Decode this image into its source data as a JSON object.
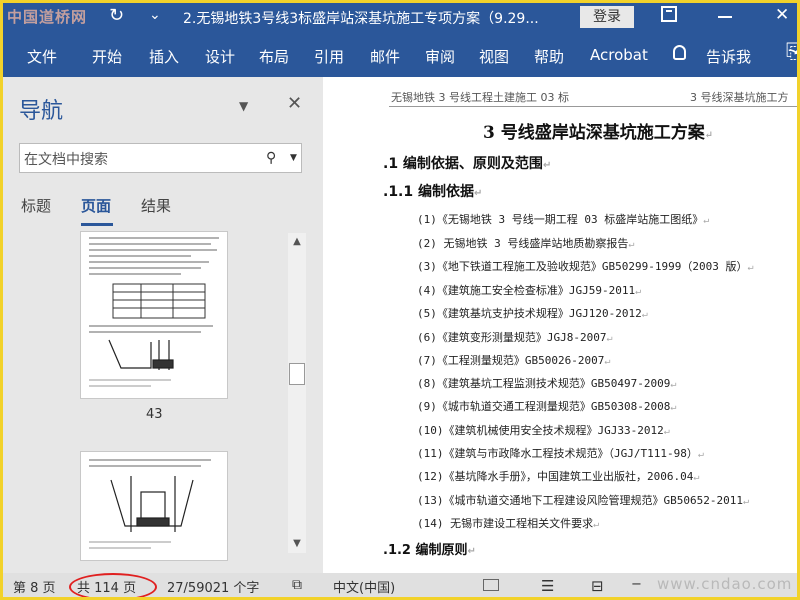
{
  "titlebar": {
    "watermark": "中国道桥网",
    "doc_title": "2.无锡地铁3号线3标盛岸站深基坑施工专项方案（9.29...",
    "login": "登录"
  },
  "ribbon": {
    "tabs": [
      "文件",
      "开始",
      "插入",
      "设计",
      "布局",
      "引用",
      "邮件",
      "审阅",
      "视图",
      "帮助",
      "Acrobat"
    ],
    "tell_me": "告诉我"
  },
  "nav": {
    "title": "导航",
    "search_placeholder": "在文档中搜索",
    "tabs": [
      "标题",
      "页面",
      "结果"
    ],
    "active_tab": "页面",
    "thumb_page_number": "43"
  },
  "document": {
    "header_left": "无锡地铁 3 号线工程土建施工 03 标",
    "header_right": "3 号线深基坑施工方",
    "title": "3 号线盛岸站深基坑施工方案",
    "sections": [
      {
        "label": ".1 编制依据、原则及范围"
      },
      {
        "label": ".1.1  编制依据"
      }
    ],
    "items": [
      "(1)《无锡地铁 3 号线一期工程 03 标盛岸站施工图纸》",
      "(2) 无锡地铁 3 号线盛岸站地质勘察报告",
      "(3)《地下铁道工程施工及验收规范》GB50299-1999（2003 版）",
      "(4)《建筑施工安全检查标准》JGJ59-2011",
      "(5)《建筑基坑支护技术规程》JGJ120-2012",
      "(6)《建筑变形测量规范》JGJ8-2007",
      "(7)《工程测量规范》GB50026-2007",
      "(8)《建筑基坑工程监测技术规范》GB50497-2009",
      "(9)《城市轨道交通工程测量规范》GB50308-2008",
      "(10)《建筑机械使用安全技术规程》JGJ33-2012",
      "(11)《建筑与市政降水工程技术规范》（JGJ/T111-98）",
      "(12)《基坑降水手册》，中国建筑工业出版社，2006.04",
      "(13)《城市轨道交通地下工程建设风险管理规范》GB50652-2011",
      "(14) 无锡市建设工程相关文件要求"
    ],
    "subsection": ".1.2  编制原则"
  },
  "statusbar": {
    "page": "第 8 页",
    "total": "共 114 页",
    "words": "27/59021 个字",
    "language": "中文(中国)",
    "watermark": "www.cndao.com"
  },
  "colors": {
    "accent": "#2b579a",
    "annotation": "#e02020",
    "frame": "#f2d22a"
  }
}
